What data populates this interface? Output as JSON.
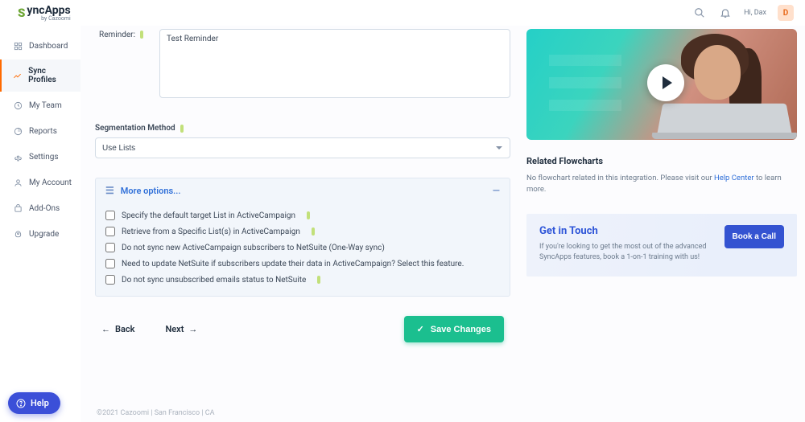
{
  "header": {
    "greeting": "Hi, Dax",
    "avatar_initial": "D"
  },
  "logo": {
    "brand": "yncApps",
    "sub": "by Cazoomi"
  },
  "sidebar": {
    "items": [
      {
        "label": "Dashboard",
        "icon": "dashboard-icon"
      },
      {
        "label": "Sync Profiles",
        "icon": "sync-icon",
        "active": true
      },
      {
        "label": "My Team",
        "icon": "team-icon"
      },
      {
        "label": "Reports",
        "icon": "reports-icon"
      },
      {
        "label": "Settings",
        "icon": "settings-icon"
      },
      {
        "label": "My Account",
        "icon": "account-icon"
      },
      {
        "label": "Add-Ons",
        "icon": "addons-icon"
      },
      {
        "label": "Upgrade",
        "icon": "upgrade-icon"
      }
    ]
  },
  "form": {
    "reminder_label": "Reminder:",
    "reminder_value": "Test Reminder",
    "segmentation_label": "Segmentation Method",
    "segmentation_value": "Use Lists",
    "more_options_title": "More options...",
    "options": [
      "Specify the default target List in ActiveCampaign",
      "Retrieve from a Specific List(s) in ActiveCampaign",
      "Do not sync new ActiveCampaign subscribers to NetSuite (One-Way sync)",
      "Need to update NetSuite if subscribers update their data in ActiveCampaign? Select this feature.",
      "Do not sync unsubscribed emails status to NetSuite"
    ],
    "option_hints": [
      true,
      true,
      false,
      false,
      true
    ]
  },
  "pager": {
    "back": "Back",
    "next": "Next"
  },
  "save_button": "Save Changes",
  "right": {
    "related_title": "Related Flowcharts",
    "related_text_pre": "No flowchart related in this integration. Please visit our ",
    "related_link": "Help Center",
    "related_text_post": " to learn more.",
    "git_title": "Get in Touch",
    "git_text": "If you're looking to get the most out of the advanced SyncApps features, book a 1-on-1 training with us!",
    "book_label": "Book a Call"
  },
  "footer": "©2021 Cazoomi | San Francisco | CA",
  "help_label": "Help"
}
